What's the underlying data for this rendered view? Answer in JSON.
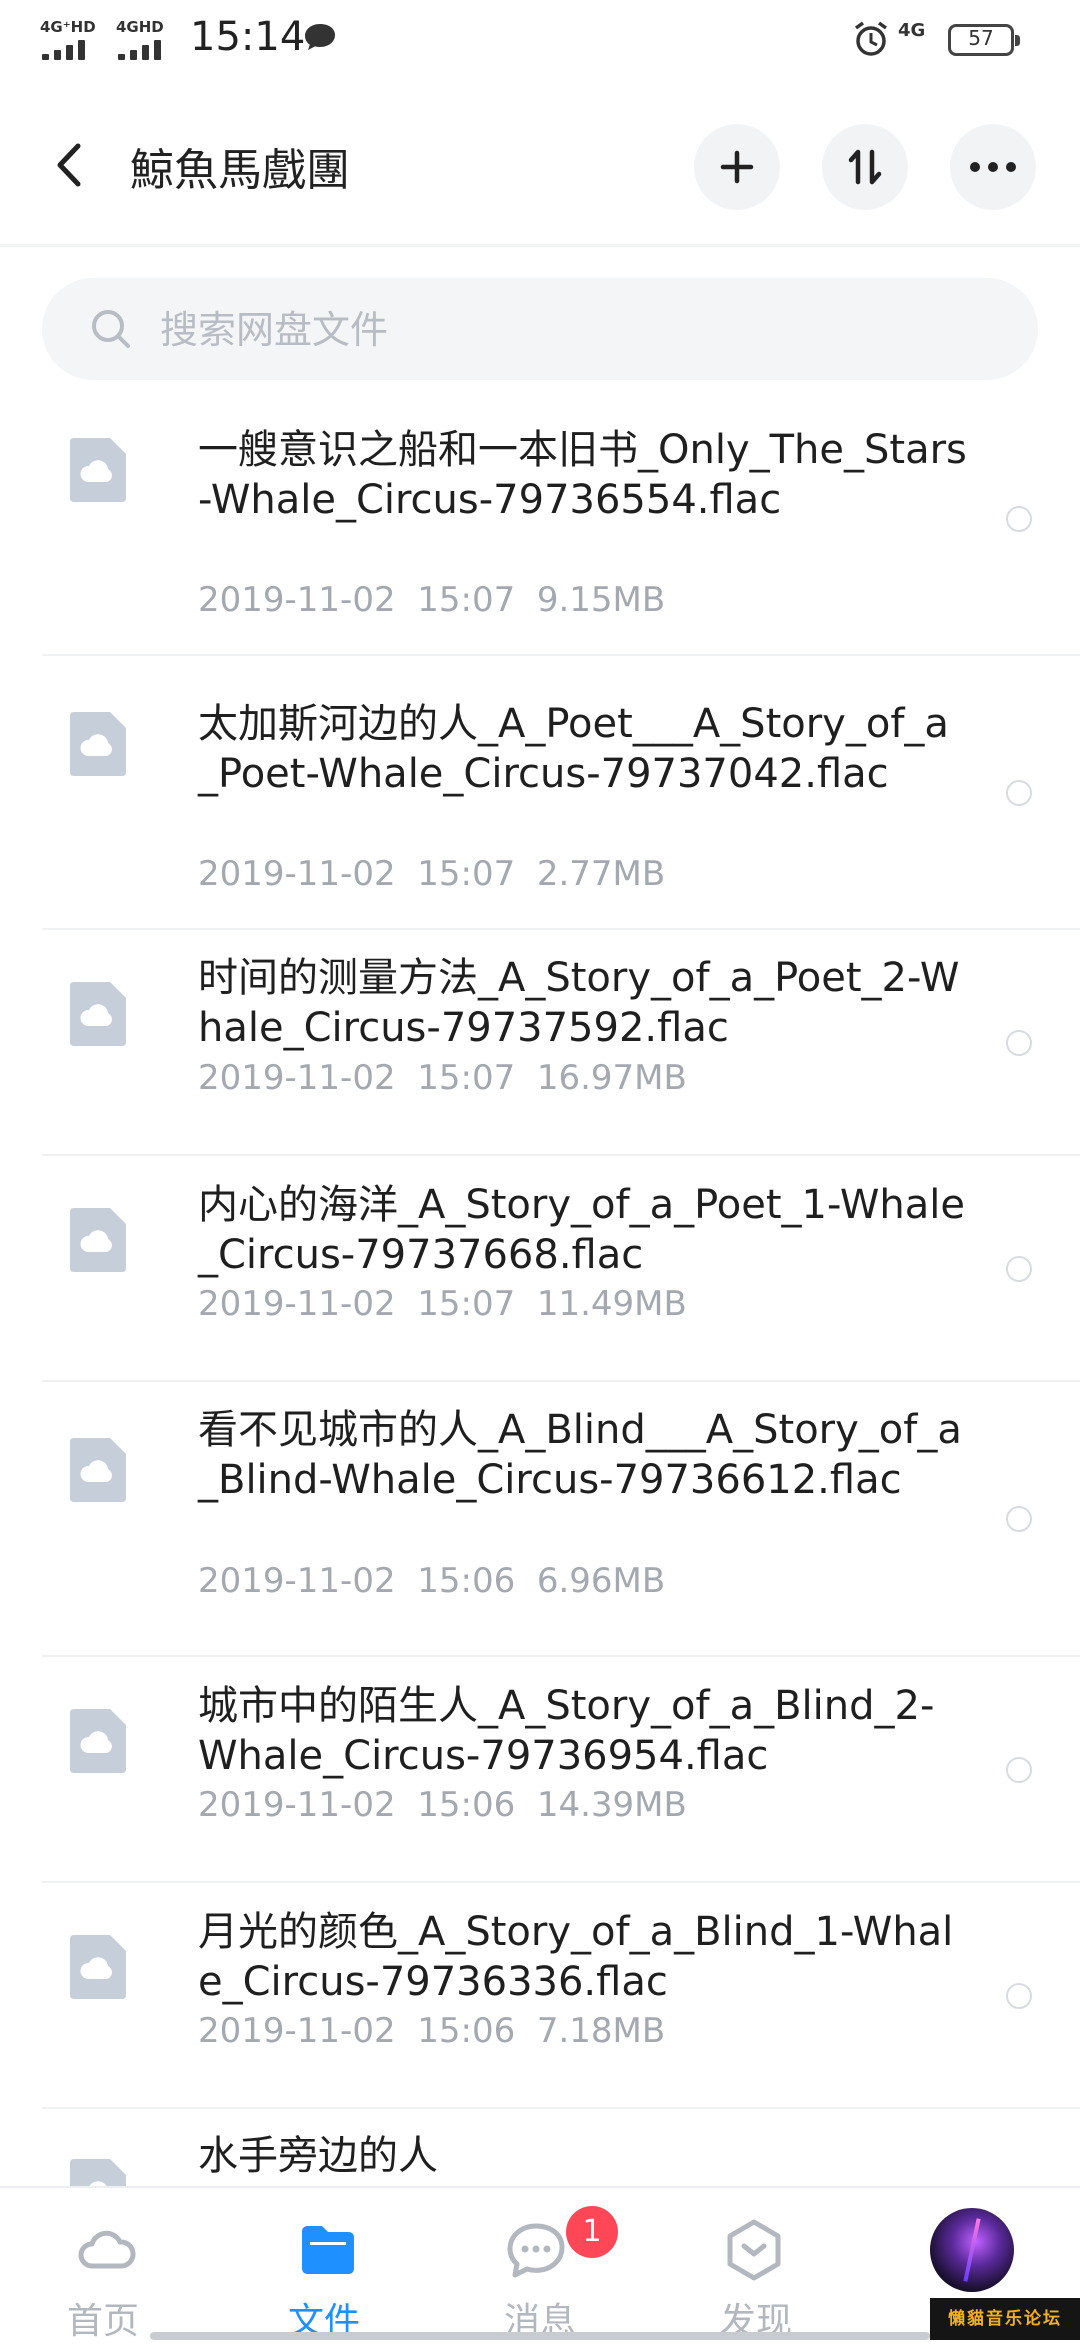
{
  "status_bar": {
    "network1": "4G⁺HD",
    "network2": "4GHD",
    "time": "15:14",
    "network_right": "4G",
    "battery": "57",
    "icons": [
      "chat-bubble-icon",
      "alarm-icon"
    ]
  },
  "header": {
    "title": "鯨魚馬戲團",
    "back_icon": "chevron-left-icon",
    "actions": [
      "plus-icon",
      "sort-icon",
      "more-icon"
    ]
  },
  "search": {
    "placeholder": "搜索网盘文件",
    "value": ""
  },
  "files": [
    {
      "name": "一艘意识之船和一本旧书_Only_The_Stars-Whale_Circus-79736554.flac",
      "date": "2019-11-02",
      "time": "15:07",
      "size": "9.15MB"
    },
    {
      "name": "太加斯河边的人_A_Poet___A_Story_of_a_Poet-Whale_Circus-79737042.flac",
      "date": "2019-11-02",
      "time": "15:07",
      "size": "2.77MB"
    },
    {
      "name": "时间的测量方法_A_Story_of_a_Poet_2-Whale_Circus-79737592.flac",
      "date": "2019-11-02",
      "time": "15:07",
      "size": "16.97MB"
    },
    {
      "name": "内心的海洋_A_Story_of_a_Poet_1-Whale_Circus-79737668.flac",
      "date": "2019-11-02",
      "time": "15:07",
      "size": "11.49MB"
    },
    {
      "name": "看不见城市的人_A_Blind___A_Story_of_a_Blind-Whale_Circus-79736612.flac",
      "date": "2019-11-02",
      "time": "15:06",
      "size": "6.96MB"
    },
    {
      "name": "城市中的陌生人_A_Story_of_a_Blind_2-Whale_Circus-79736954.flac",
      "date": "2019-11-02",
      "time": "15:06",
      "size": "14.39MB"
    },
    {
      "name": "月光的颜色_A_Story_of_a_Blind_1-Whale_Circus-79736336.flac",
      "date": "2019-11-02",
      "time": "15:06",
      "size": "7.18MB"
    },
    {
      "name": "水手旁边的人",
      "date": "",
      "time": "",
      "size": ""
    }
  ],
  "bottom_nav": {
    "items": [
      {
        "label": "首页",
        "icon": "cloud-home-icon",
        "active": false
      },
      {
        "label": "文件",
        "icon": "folder-icon",
        "active": true
      },
      {
        "label": "消息",
        "icon": "message-icon",
        "active": false
      },
      {
        "label": "发现",
        "icon": "discover-icon",
        "active": false
      }
    ],
    "message_badge": "1"
  },
  "watermark": "懶貓音乐论坛",
  "colors": {
    "accent": "#1e90ff",
    "badge": "#ff4757",
    "meta_text": "#a4a8b0",
    "thumb": "#c5ced9"
  }
}
